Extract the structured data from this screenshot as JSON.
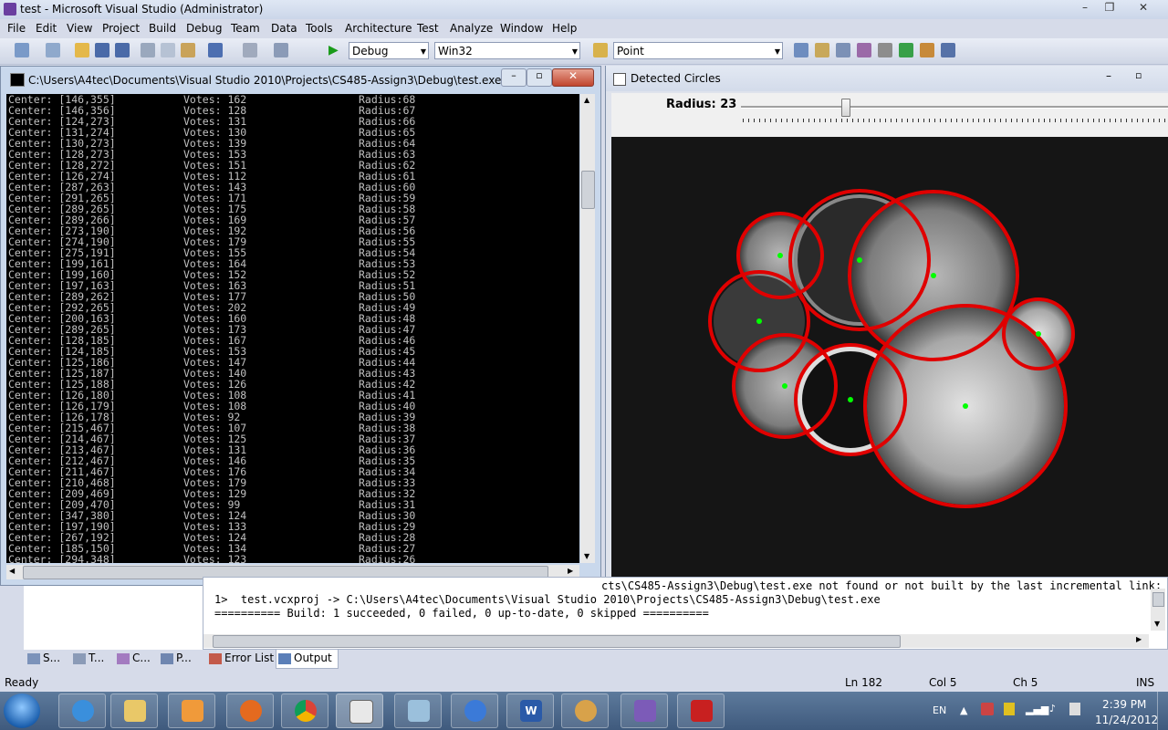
{
  "window": {
    "title": "test - Microsoft Visual Studio (Administrator)"
  },
  "menu": [
    "File",
    "Edit",
    "View",
    "Project",
    "Build",
    "Debug",
    "Team",
    "Data",
    "Tools",
    "Architecture",
    "Test",
    "Analyze",
    "Window",
    "Help"
  ],
  "toolbar": {
    "config": "Debug",
    "platform": "Win32",
    "find": "Point"
  },
  "console": {
    "title": "C:\\Users\\A4tec\\Documents\\Visual Studio 2010\\Projects\\CS485-Assign3\\Debug\\test.exe",
    "rows": [
      {
        "center": "Center: [146,355]",
        "votes": "Votes: 162",
        "radius": "Radius:68"
      },
      {
        "center": "Center: [146,356]",
        "votes": "Votes: 128",
        "radius": "Radius:67"
      },
      {
        "center": "Center: [124,273]",
        "votes": "Votes: 131",
        "radius": "Radius:66"
      },
      {
        "center": "Center: [131,274]",
        "votes": "Votes: 130",
        "radius": "Radius:65"
      },
      {
        "center": "Center: [130,273]",
        "votes": "Votes: 139",
        "radius": "Radius:64"
      },
      {
        "center": "Center: [128,273]",
        "votes": "Votes: 153",
        "radius": "Radius:63"
      },
      {
        "center": "Center: [128,272]",
        "votes": "Votes: 151",
        "radius": "Radius:62"
      },
      {
        "center": "Center: [126,274]",
        "votes": "Votes: 112",
        "radius": "Radius:61"
      },
      {
        "center": "Center: [287,263]",
        "votes": "Votes: 143",
        "radius": "Radius:60"
      },
      {
        "center": "Center: [291,265]",
        "votes": "Votes: 171",
        "radius": "Radius:59"
      },
      {
        "center": "Center: [289,265]",
        "votes": "Votes: 175",
        "radius": "Radius:58"
      },
      {
        "center": "Center: [289,266]",
        "votes": "Votes: 169",
        "radius": "Radius:57"
      },
      {
        "center": "Center: [273,190]",
        "votes": "Votes: 192",
        "radius": "Radius:56"
      },
      {
        "center": "Center: [274,190]",
        "votes": "Votes: 179",
        "radius": "Radius:55"
      },
      {
        "center": "Center: [275,191]",
        "votes": "Votes: 155",
        "radius": "Radius:54"
      },
      {
        "center": "Center: [199,161]",
        "votes": "Votes: 164",
        "radius": "Radius:53"
      },
      {
        "center": "Center: [199,160]",
        "votes": "Votes: 152",
        "radius": "Radius:52"
      },
      {
        "center": "Center: [197,163]",
        "votes": "Votes: 163",
        "radius": "Radius:51"
      },
      {
        "center": "Center: [289,262]",
        "votes": "Votes: 177",
        "radius": "Radius:50"
      },
      {
        "center": "Center: [292,265]",
        "votes": "Votes: 202",
        "radius": "Radius:49"
      },
      {
        "center": "Center: [200,163]",
        "votes": "Votes: 160",
        "radius": "Radius:48"
      },
      {
        "center": "Center: [289,265]",
        "votes": "Votes: 173",
        "radius": "Radius:47"
      },
      {
        "center": "Center: [128,185]",
        "votes": "Votes: 167",
        "radius": "Radius:46"
      },
      {
        "center": "Center: [124,185]",
        "votes": "Votes: 153",
        "radius": "Radius:45"
      },
      {
        "center": "Center: [125,186]",
        "votes": "Votes: 147",
        "radius": "Radius:44"
      },
      {
        "center": "Center: [125,187]",
        "votes": "Votes: 140",
        "radius": "Radius:43"
      },
      {
        "center": "Center: [125,188]",
        "votes": "Votes: 126",
        "radius": "Radius:42"
      },
      {
        "center": "Center: [126,180]",
        "votes": "Votes: 108",
        "radius": "Radius:41"
      },
      {
        "center": "Center: [126,179]",
        "votes": "Votes: 108",
        "radius": "Radius:40"
      },
      {
        "center": "Center: [126,178]",
        "votes": "Votes: 92",
        "radius": "Radius:39"
      },
      {
        "center": "Center: [215,467]",
        "votes": "Votes: 107",
        "radius": "Radius:38"
      },
      {
        "center": "Center: [214,467]",
        "votes": "Votes: 125",
        "radius": "Radius:37"
      },
      {
        "center": "Center: [213,467]",
        "votes": "Votes: 131",
        "radius": "Radius:36"
      },
      {
        "center": "Center: [212,467]",
        "votes": "Votes: 146",
        "radius": "Radius:35"
      },
      {
        "center": "Center: [211,467]",
        "votes": "Votes: 176",
        "radius": "Radius:34"
      },
      {
        "center": "Center: [210,468]",
        "votes": "Votes: 179",
        "radius": "Radius:33"
      },
      {
        "center": "Center: [209,469]",
        "votes": "Votes: 129",
        "radius": "Radius:32"
      },
      {
        "center": "Center: [209,470]",
        "votes": "Votes: 99",
        "radius": "Radius:31"
      },
      {
        "center": "Center: [347,380]",
        "votes": "Votes: 124",
        "radius": "Radius:30"
      },
      {
        "center": "Center: [197,190]",
        "votes": "Votes: 133",
        "radius": "Radius:29"
      },
      {
        "center": "Center: [267,192]",
        "votes": "Votes: 124",
        "radius": "Radius:28"
      },
      {
        "center": "Center: [185,150]",
        "votes": "Votes: 134",
        "radius": "Radius:27"
      },
      {
        "center": "Center: [294,348]",
        "votes": "Votes: 123",
        "radius": "Radius:26"
      }
    ]
  },
  "detected": {
    "title": "Detected Circles",
    "radius_label": "Radius: 23"
  },
  "output": {
    "lines": [
      "cts\\CS485-Assign3\\Debug\\test.exe not found or not built by the last incremental link;",
      "1>  test.vcxproj -> C:\\Users\\A4tec\\Documents\\Visual Studio 2010\\Projects\\CS485-Assign3\\Debug\\test.exe",
      "========== Build: 1 succeeded, 0 failed, 0 up-to-date, 0 skipped =========="
    ]
  },
  "tabs": {
    "sol": "S...",
    "team": "T...",
    "class": "C...",
    "prop": "P...",
    "errors": "Error List",
    "output": "Output"
  },
  "status": {
    "ready": "Ready",
    "ln": "Ln 182",
    "col": "Col 5",
    "ch": "Ch 5",
    "ins": "INS"
  },
  "tray": {
    "lang": "EN",
    "time": "2:39 PM",
    "date": "11/24/2012"
  }
}
